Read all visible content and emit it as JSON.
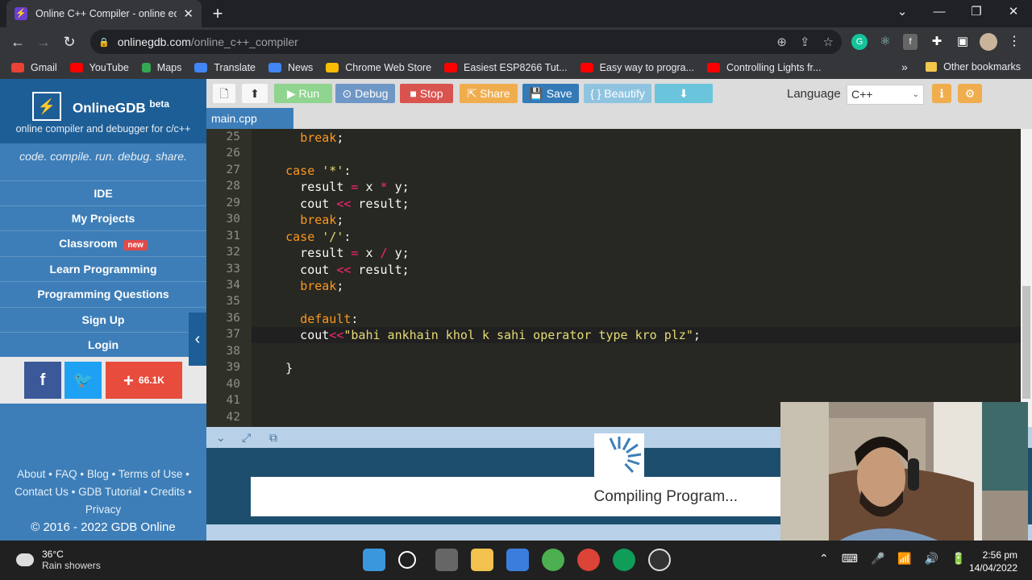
{
  "browser": {
    "tab_title": "Online C++ Compiler - online ed",
    "tab_favicon": "⚡",
    "url_host": "onlinegdb.com",
    "url_path": "/online_c++_compiler",
    "bookmarks": [
      {
        "label": "Gmail",
        "icon": "gmail-icon",
        "color": "#ea4335"
      },
      {
        "label": "YouTube",
        "icon": "youtube-icon",
        "color": "#ff0000"
      },
      {
        "label": "Maps",
        "icon": "maps-icon",
        "color": "#34a853"
      },
      {
        "label": "Translate",
        "icon": "translate-icon",
        "color": "#4285f4"
      },
      {
        "label": "News",
        "icon": "news-icon",
        "color": "#4285f4"
      },
      {
        "label": "Chrome Web Store",
        "icon": "webstore-icon",
        "color": "#fbbc05"
      },
      {
        "label": "Easiest ESP8266 Tut...",
        "icon": "youtube-icon",
        "color": "#ff0000"
      },
      {
        "label": "Easy way to progra...",
        "icon": "youtube-icon",
        "color": "#ff0000"
      },
      {
        "label": "Controlling Lights fr...",
        "icon": "youtube-icon",
        "color": "#ff0000"
      }
    ],
    "more_bookmarks": "»",
    "other_bookmarks": "Other bookmarks"
  },
  "sidebar": {
    "brand": "OnlineGDB",
    "brand_sup": "beta",
    "brand_sub": "online compiler and debugger for c/c++",
    "tagline": "code. compile. run. debug. share.",
    "nav": [
      {
        "label": "IDE"
      },
      {
        "label": "My Projects"
      },
      {
        "label": "Classroom",
        "badge": "new"
      },
      {
        "label": "Learn Programming"
      },
      {
        "label": "Programming Questions"
      },
      {
        "label": "Sign Up"
      },
      {
        "label": "Login"
      }
    ],
    "share_count": "66.1K",
    "footer_line1": "About • FAQ • Blog • Terms of Use •",
    "footer_line2": "Contact Us • GDB Tutorial • Credits •",
    "footer_line3": "Privacy",
    "copyright": "© 2016 - 2022 GDB Online"
  },
  "toolbar": {
    "run": "Run",
    "debug": "Debug",
    "stop": "Stop",
    "share": "Share",
    "save": "Save",
    "beautify": "{ } Beautify",
    "language_label": "Language",
    "language_value": "C++"
  },
  "editor": {
    "file_tab": "main.cpp",
    "line_numbers": [
      "25",
      "26",
      "27",
      "28",
      "29",
      "30",
      "31",
      "32",
      "33",
      "34",
      "35",
      "36",
      "37",
      "38",
      "39",
      "40",
      "41",
      "42"
    ]
  },
  "output": {
    "status": "Compiling Program..."
  },
  "taskbar": {
    "temperature": "36°C",
    "weather": "Rain showers",
    "time": "2:56 pm",
    "date": "14/04/2022"
  }
}
